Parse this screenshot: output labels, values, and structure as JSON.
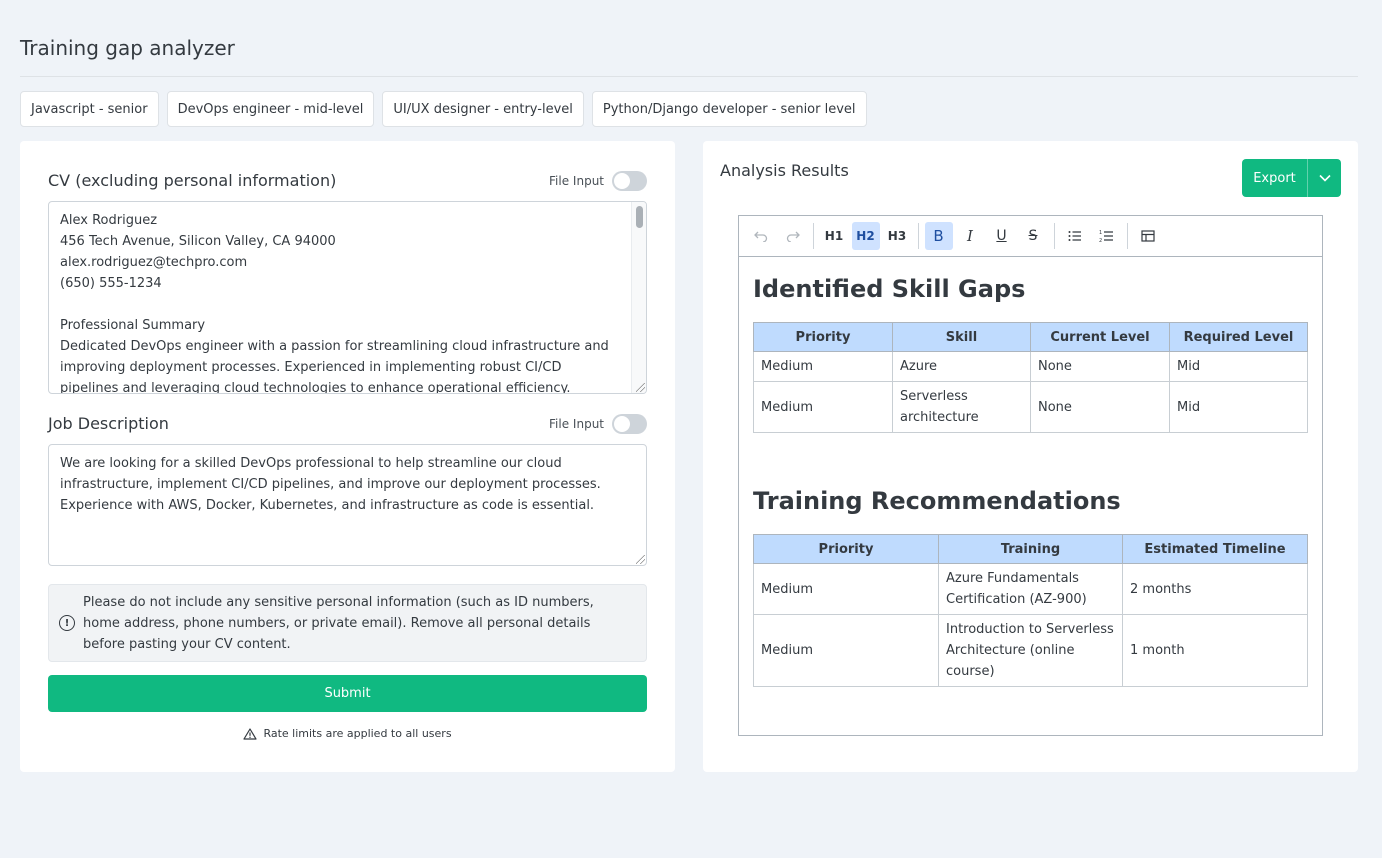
{
  "app": {
    "title": "Training gap analyzer"
  },
  "presets": [
    "Javascript - senior",
    "DevOps engineer - mid-level",
    "UI/UX designer - entry-level",
    "Python/Django developer - senior level"
  ],
  "cv": {
    "label": "CV (excluding personal information)",
    "file_input_label": "File Input",
    "value": "Alex Rodriguez\n456 Tech Avenue, Silicon Valley, CA 94000\nalex.rodriguez@techpro.com\n(650) 555-1234\n\nProfessional Summary\nDedicated DevOps engineer with a passion for streamlining cloud infrastructure and improving deployment processes. Experienced in implementing robust CI/CD pipelines and leveraging cloud technologies to enhance operational efficiency."
  },
  "job": {
    "label": "Job Description",
    "file_input_label": "File Input",
    "value": "We are looking for a skilled DevOps professional to help streamline our cloud infrastructure, implement CI/CD pipelines, and improve our deployment processes. Experience with AWS, Docker, Kubernetes, and infrastructure as code is essential."
  },
  "notice": "Please do not include any sensitive personal information (such as ID numbers, home address, phone numbers, or private email). Remove all personal details before pasting your CV content.",
  "submit_label": "Submit",
  "rate_limit_text": "Rate limits are applied to all users",
  "results": {
    "title": "Analysis Results",
    "export_label": "Export",
    "toolbar": {
      "h1": "H1",
      "h2": "H2",
      "h3": "H3",
      "bold": "B",
      "italic": "I",
      "underline": "U",
      "strike": "S"
    },
    "skill_gaps": {
      "heading": "Identified Skill Gaps",
      "headers": [
        "Priority",
        "Skill",
        "Current Level",
        "Required Level"
      ],
      "rows": [
        [
          "Medium",
          "Azure",
          "None",
          "Mid"
        ],
        [
          "Medium",
          "Serverless architecture",
          "None",
          "Mid"
        ]
      ]
    },
    "training": {
      "heading": "Training Recommendations",
      "headers": [
        "Priority",
        "Training",
        "Estimated Timeline"
      ],
      "rows": [
        [
          "Medium",
          "Azure Fundamentals Certification (AZ-900)",
          "2 months"
        ],
        [
          "Medium",
          "Introduction to Serverless Architecture (online course)",
          "1 month"
        ]
      ]
    }
  },
  "colors": {
    "accent": "#10b981",
    "table_header": "#bfdbfe",
    "background": "#eff3f8"
  }
}
